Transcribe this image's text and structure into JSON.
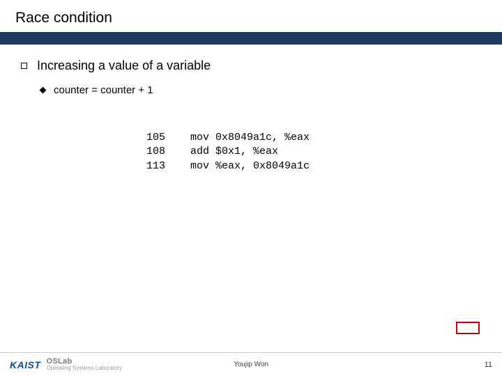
{
  "title": "Race condition",
  "bullet_main": "Increasing a value of a variable",
  "bullet_sub": "counter = counter + 1",
  "code": {
    "l1_addr": "105",
    "l1_instr": "mov 0x8049a1c, %eax",
    "l2_addr": "108",
    "l2_instr": "add $0x1, %eax",
    "l3_addr": "113",
    "l3_instr": "mov %eax, 0x8049a1c"
  },
  "footer": {
    "org1": "KAIST",
    "org2_top": "OSLab",
    "org2_bot": "Operating Systems Laboratory",
    "author": "Youjip Won",
    "page": "11"
  }
}
